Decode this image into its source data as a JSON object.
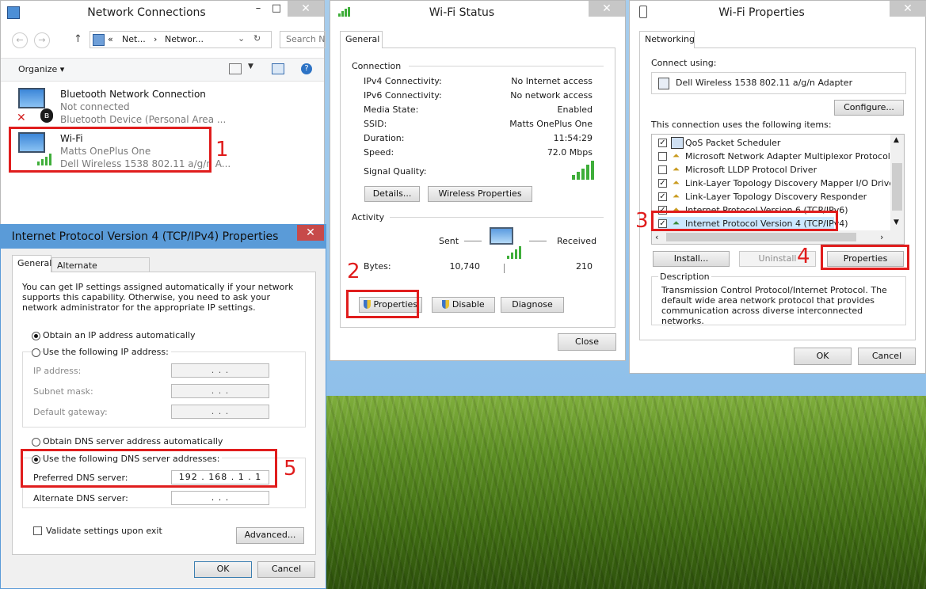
{
  "network_connections": {
    "title": "Network Connections",
    "address_crumbs": [
      "«",
      "Net...",
      "›",
      "Networ..."
    ],
    "search_placeholder": "Search N",
    "organize_label": "Organize ▾",
    "items": [
      {
        "name": "Bluetooth Network Connection",
        "status": "Not connected",
        "device": "Bluetooth Device (Personal Area ..."
      },
      {
        "name": "Wi-Fi",
        "status": "Matts OnePlus One",
        "device": "Dell Wireless 1538 802.11 a/g/n A..."
      }
    ]
  },
  "wifi_status": {
    "title": "Wi-Fi Status",
    "tab": "General",
    "connection_heading": "Connection",
    "rows": [
      {
        "label": "IPv4 Connectivity:",
        "value": "No Internet access"
      },
      {
        "label": "IPv6 Connectivity:",
        "value": "No network access"
      },
      {
        "label": "Media State:",
        "value": "Enabled"
      },
      {
        "label": "SSID:",
        "value": "Matts OnePlus One"
      },
      {
        "label": "Duration:",
        "value": "11:54:29"
      },
      {
        "label": "Speed:",
        "value": "72.0 Mbps"
      }
    ],
    "signal_quality_label": "Signal Quality:",
    "details_button": "Details...",
    "wireless_properties_button": "Wireless Properties",
    "activity_heading": "Activity",
    "sent_label": "Sent",
    "received_label": "Received",
    "bytes_label": "Bytes:",
    "bytes_sent": "10,740",
    "bytes_received": "210",
    "properties_button": "Properties",
    "disable_button": "Disable",
    "diagnose_button": "Diagnose",
    "close_button": "Close"
  },
  "wifi_properties": {
    "title": "Wi-Fi Properties",
    "tab": "Networking",
    "connect_using_label": "Connect using:",
    "adapter": "Dell Wireless 1538 802.11 a/g/n Adapter",
    "configure_button": "Configure...",
    "items_label": "This connection uses the following items:",
    "items": [
      {
        "label": "QoS Packet Scheduler",
        "checked": true
      },
      {
        "label": "Microsoft Network Adapter Multiplexor Protocol",
        "checked": false
      },
      {
        "label": "Microsoft LLDP Protocol Driver",
        "checked": false
      },
      {
        "label": "Link-Layer Topology Discovery Mapper I/O Driver",
        "checked": true
      },
      {
        "label": "Link-Layer Topology Discovery Responder",
        "checked": true
      },
      {
        "label": "Internet Protocol Version 6 (TCP/IPv6)",
        "checked": true
      },
      {
        "label": "Internet Protocol Version 4 (TCP/IPv4)",
        "checked": true
      }
    ],
    "install_button": "Install...",
    "uninstall_button": "Uninstall",
    "properties_button": "Properties",
    "description_heading": "Description",
    "description_text": "Transmission Control Protocol/Internet Protocol. The default wide area network protocol that provides communication across diverse interconnected networks.",
    "ok_button": "OK",
    "cancel_button": "Cancel"
  },
  "ipv4_properties": {
    "title": "Internet Protocol Version 4 (TCP/IPv4) Properties",
    "tab_general": "General",
    "tab_alternate": "Alternate Configuration",
    "intro_text": "You can get IP settings assigned automatically if your network supports this capability. Otherwise, you need to ask your network administrator for the appropriate IP settings.",
    "obtain_ip_auto": "Obtain an IP address automatically",
    "use_following_ip": "Use the following IP address:",
    "ip_address_label": "IP address:",
    "subnet_mask_label": "Subnet mask:",
    "default_gateway_label": "Default gateway:",
    "empty_ip": ".       .       .",
    "obtain_dns_auto": "Obtain DNS server address automatically",
    "use_following_dns": "Use the following DNS server addresses:",
    "preferred_dns_label": "Preferred DNS server:",
    "preferred_dns_value": "192 . 168 .  1  .  1",
    "alternate_dns_label": "Alternate DNS server:",
    "validate_label": "Validate settings upon exit",
    "advanced_button": "Advanced...",
    "ok_button": "OK",
    "cancel_button": "Cancel"
  },
  "annotations": [
    "1",
    "2",
    "3",
    "4",
    "5"
  ],
  "colors": {
    "annotation_red": "#e01d1d",
    "signal_green": "#3fae3a",
    "selected_blue": "#cce8ff"
  }
}
